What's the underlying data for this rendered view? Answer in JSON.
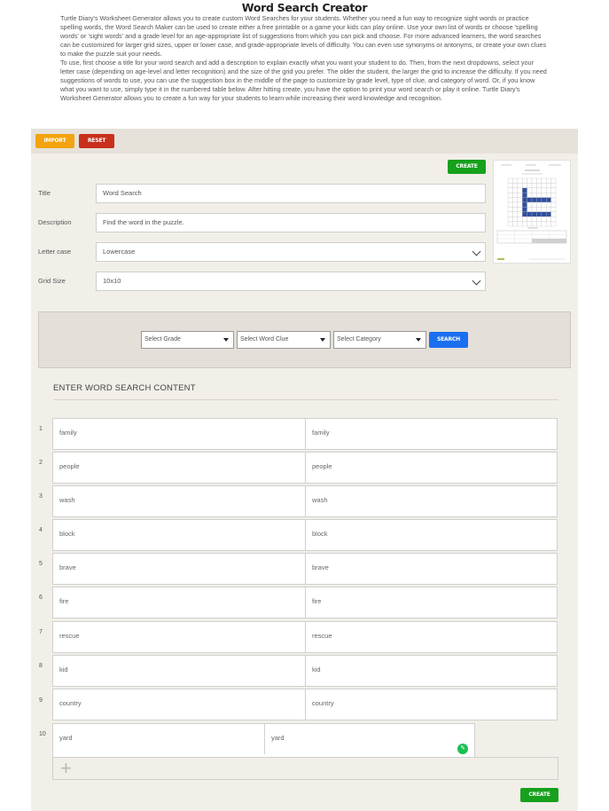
{
  "page": {
    "title": "Word Search Creator",
    "intro_p1": "Turtle Diary's Worksheet Generator allows you to create custom Word Searches for your students. Whether you need a fun way to recognize sight words or practice spelling words, the Word Search Maker can be used to create either a free printable or a game your kids can play online. Use your own list of words or choose 'spelling words' or 'sight words' and a grade level for an age-appropriate list of suggestions from which you can pick and choose. For more advanced learners, the word searches can be customized for larger grid sizes, upper or lower case, and grade-appropriate levels of difficulty. You can even use synonyms or antonyms, or create your own clues to make the puzzle suit your needs.",
    "intro_p2": "To use, first choose a title for your word search and add a description to explain exactly what you want your student to do. Then, from the next dropdowns, select your letter case (depending on age-level and letter recognition) and the size of the grid you prefer. The older the student, the larger the grid to increase the difficulty. If you need suggestions of words to use, you can use the suggestion box in the middle of the page to customize by grade level, type of clue, and category of word. Or, if you know what you want to use, simply type it in the numbered table below. After hitting create, you have the option to print your word search or play it online. Turtle Diary's Worksheet Generator allows you to create a fun way for your students to learn while increasing their word knowledge and recognition."
  },
  "toolbar": {
    "import_label": "IMPORT",
    "reset_label": "RESET",
    "create_label": "CREATE"
  },
  "form": {
    "title_label": "Title",
    "title_value": "Word Search",
    "description_label": "Description",
    "description_value": "Find the word in the puzzle.",
    "letter_case_label": "Letter case",
    "letter_case_value": "Lowercase",
    "grid_size_label": "Grid Size",
    "grid_size_value": "10x10"
  },
  "suggest": {
    "grade": "Select Grade",
    "word_clue": "Select Word Clue",
    "category": "Select Category",
    "search_label": "SEARCH"
  },
  "content": {
    "heading": "ENTER WORD SEARCH CONTENT",
    "rows": [
      {
        "num": "1",
        "word": "family",
        "clue": "family"
      },
      {
        "num": "2",
        "word": "people",
        "clue": "people"
      },
      {
        "num": "3",
        "word": "wash",
        "clue": "wash"
      },
      {
        "num": "4",
        "word": "block",
        "clue": "block"
      },
      {
        "num": "5",
        "word": "brave",
        "clue": "brave"
      },
      {
        "num": "6",
        "word": "fire",
        "clue": "fire"
      },
      {
        "num": "7",
        "word": "rescue",
        "clue": "rescue"
      },
      {
        "num": "8",
        "word": "kid",
        "clue": "kid"
      },
      {
        "num": "9",
        "word": "country",
        "clue": "country"
      },
      {
        "num": "10",
        "word": "yard",
        "clue": "yard"
      }
    ],
    "add_symbol": "+"
  },
  "bottom": {
    "create_label": "CREATE"
  },
  "colors": {
    "import": "#f2a30f",
    "reset": "#c9301c",
    "create": "#17a01c",
    "search": "#1a6ff0",
    "grid_highlight": "#2f4f9e"
  },
  "icons": {
    "dropdown": "chevron-down-icon",
    "edit": "pencil-icon",
    "add": "plus-icon"
  }
}
